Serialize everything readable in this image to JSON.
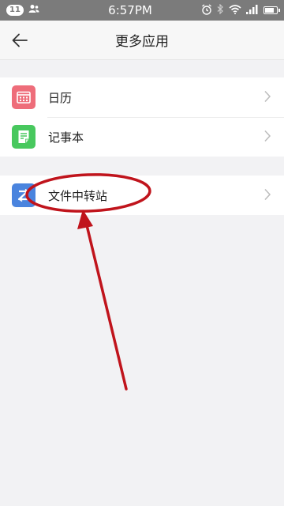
{
  "status_bar": {
    "notification_count": "11",
    "time": "6:57PM",
    "battery_icon": "battery-icon",
    "alarm_icon": "alarm-icon",
    "bluetooth_icon": "bluetooth-icon",
    "wifi_icon": "wifi-icon",
    "signal_icon": "signal-icon"
  },
  "header": {
    "title": "更多应用",
    "back_icon": "back-arrow-icon"
  },
  "groups": [
    {
      "items": [
        {
          "label": "日历",
          "icon": "calendar-icon",
          "color": "#ee6d7a"
        },
        {
          "label": "记事本",
          "icon": "notepad-icon",
          "color": "#48c85e"
        }
      ]
    },
    {
      "items": [
        {
          "label": "文件中转站",
          "icon": "file-transfer-icon",
          "color": "#4a84de"
        }
      ]
    }
  ],
  "annotation": {
    "color": "#c0141c"
  }
}
